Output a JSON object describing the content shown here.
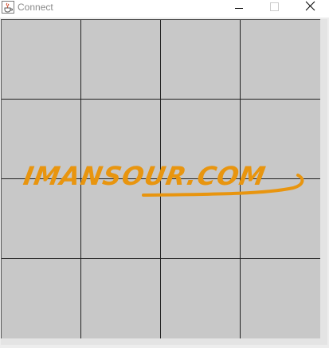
{
  "window": {
    "title": "Connect",
    "app_icon": "java-cup-icon",
    "controls": {
      "minimize": "minimize-icon",
      "maximize": "maximize-icon",
      "close": "close-icon"
    }
  },
  "board": {
    "rows": 4,
    "columns": 4,
    "cell_color": "#c8c8c8",
    "line_color": "#222222"
  },
  "watermark": {
    "text": "IMANSOUR.COM",
    "color": "#e8950f"
  }
}
